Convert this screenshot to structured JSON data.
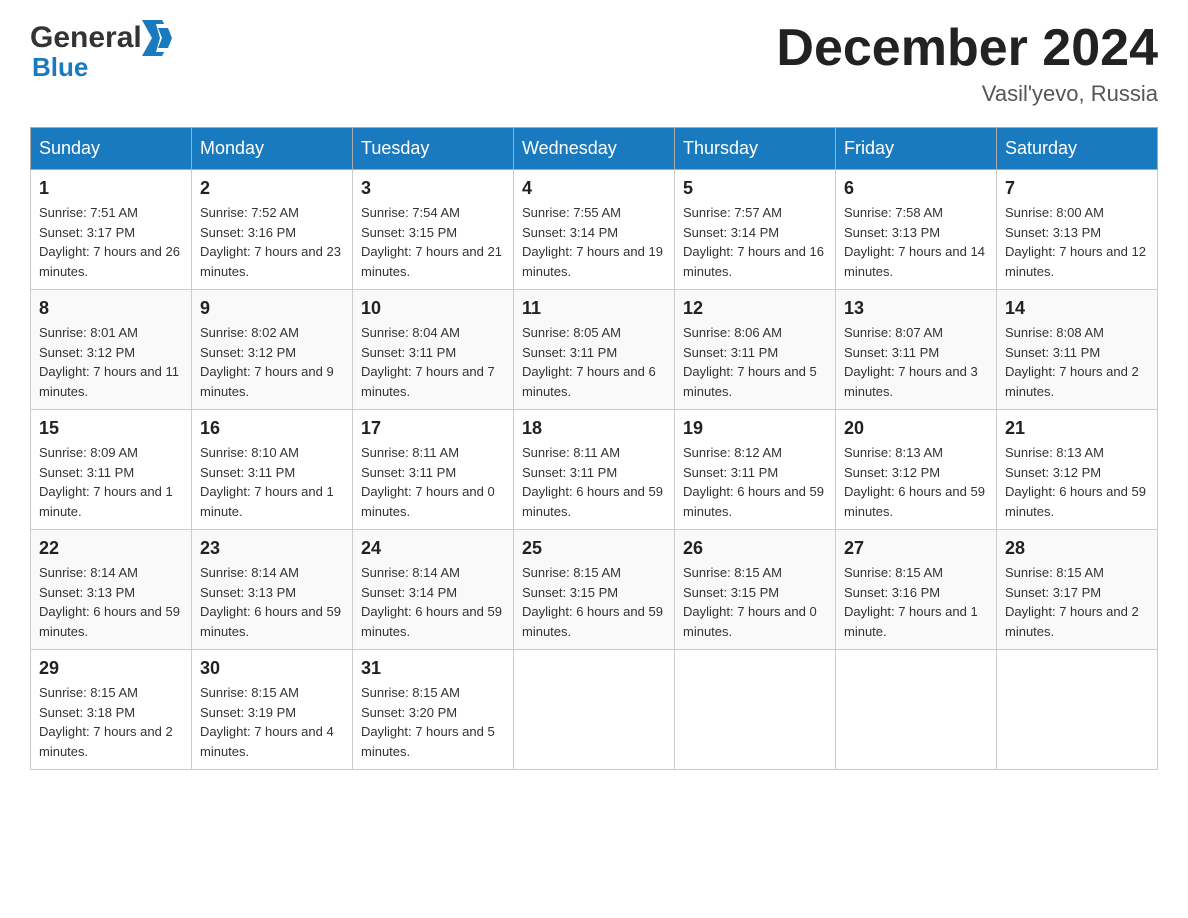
{
  "header": {
    "logo_general": "General",
    "logo_blue": "Blue",
    "month_title": "December 2024",
    "location": "Vasil'yevo, Russia"
  },
  "days_of_week": [
    "Sunday",
    "Monday",
    "Tuesday",
    "Wednesday",
    "Thursday",
    "Friday",
    "Saturday"
  ],
  "weeks": [
    [
      {
        "day": "1",
        "sunrise": "Sunrise: 7:51 AM",
        "sunset": "Sunset: 3:17 PM",
        "daylight": "Daylight: 7 hours and 26 minutes."
      },
      {
        "day": "2",
        "sunrise": "Sunrise: 7:52 AM",
        "sunset": "Sunset: 3:16 PM",
        "daylight": "Daylight: 7 hours and 23 minutes."
      },
      {
        "day": "3",
        "sunrise": "Sunrise: 7:54 AM",
        "sunset": "Sunset: 3:15 PM",
        "daylight": "Daylight: 7 hours and 21 minutes."
      },
      {
        "day": "4",
        "sunrise": "Sunrise: 7:55 AM",
        "sunset": "Sunset: 3:14 PM",
        "daylight": "Daylight: 7 hours and 19 minutes."
      },
      {
        "day": "5",
        "sunrise": "Sunrise: 7:57 AM",
        "sunset": "Sunset: 3:14 PM",
        "daylight": "Daylight: 7 hours and 16 minutes."
      },
      {
        "day": "6",
        "sunrise": "Sunrise: 7:58 AM",
        "sunset": "Sunset: 3:13 PM",
        "daylight": "Daylight: 7 hours and 14 minutes."
      },
      {
        "day": "7",
        "sunrise": "Sunrise: 8:00 AM",
        "sunset": "Sunset: 3:13 PM",
        "daylight": "Daylight: 7 hours and 12 minutes."
      }
    ],
    [
      {
        "day": "8",
        "sunrise": "Sunrise: 8:01 AM",
        "sunset": "Sunset: 3:12 PM",
        "daylight": "Daylight: 7 hours and 11 minutes."
      },
      {
        "day": "9",
        "sunrise": "Sunrise: 8:02 AM",
        "sunset": "Sunset: 3:12 PM",
        "daylight": "Daylight: 7 hours and 9 minutes."
      },
      {
        "day": "10",
        "sunrise": "Sunrise: 8:04 AM",
        "sunset": "Sunset: 3:11 PM",
        "daylight": "Daylight: 7 hours and 7 minutes."
      },
      {
        "day": "11",
        "sunrise": "Sunrise: 8:05 AM",
        "sunset": "Sunset: 3:11 PM",
        "daylight": "Daylight: 7 hours and 6 minutes."
      },
      {
        "day": "12",
        "sunrise": "Sunrise: 8:06 AM",
        "sunset": "Sunset: 3:11 PM",
        "daylight": "Daylight: 7 hours and 5 minutes."
      },
      {
        "day": "13",
        "sunrise": "Sunrise: 8:07 AM",
        "sunset": "Sunset: 3:11 PM",
        "daylight": "Daylight: 7 hours and 3 minutes."
      },
      {
        "day": "14",
        "sunrise": "Sunrise: 8:08 AM",
        "sunset": "Sunset: 3:11 PM",
        "daylight": "Daylight: 7 hours and 2 minutes."
      }
    ],
    [
      {
        "day": "15",
        "sunrise": "Sunrise: 8:09 AM",
        "sunset": "Sunset: 3:11 PM",
        "daylight": "Daylight: 7 hours and 1 minute."
      },
      {
        "day": "16",
        "sunrise": "Sunrise: 8:10 AM",
        "sunset": "Sunset: 3:11 PM",
        "daylight": "Daylight: 7 hours and 1 minute."
      },
      {
        "day": "17",
        "sunrise": "Sunrise: 8:11 AM",
        "sunset": "Sunset: 3:11 PM",
        "daylight": "Daylight: 7 hours and 0 minutes."
      },
      {
        "day": "18",
        "sunrise": "Sunrise: 8:11 AM",
        "sunset": "Sunset: 3:11 PM",
        "daylight": "Daylight: 6 hours and 59 minutes."
      },
      {
        "day": "19",
        "sunrise": "Sunrise: 8:12 AM",
        "sunset": "Sunset: 3:11 PM",
        "daylight": "Daylight: 6 hours and 59 minutes."
      },
      {
        "day": "20",
        "sunrise": "Sunrise: 8:13 AM",
        "sunset": "Sunset: 3:12 PM",
        "daylight": "Daylight: 6 hours and 59 minutes."
      },
      {
        "day": "21",
        "sunrise": "Sunrise: 8:13 AM",
        "sunset": "Sunset: 3:12 PM",
        "daylight": "Daylight: 6 hours and 59 minutes."
      }
    ],
    [
      {
        "day": "22",
        "sunrise": "Sunrise: 8:14 AM",
        "sunset": "Sunset: 3:13 PM",
        "daylight": "Daylight: 6 hours and 59 minutes."
      },
      {
        "day": "23",
        "sunrise": "Sunrise: 8:14 AM",
        "sunset": "Sunset: 3:13 PM",
        "daylight": "Daylight: 6 hours and 59 minutes."
      },
      {
        "day": "24",
        "sunrise": "Sunrise: 8:14 AM",
        "sunset": "Sunset: 3:14 PM",
        "daylight": "Daylight: 6 hours and 59 minutes."
      },
      {
        "day": "25",
        "sunrise": "Sunrise: 8:15 AM",
        "sunset": "Sunset: 3:15 PM",
        "daylight": "Daylight: 6 hours and 59 minutes."
      },
      {
        "day": "26",
        "sunrise": "Sunrise: 8:15 AM",
        "sunset": "Sunset: 3:15 PM",
        "daylight": "Daylight: 7 hours and 0 minutes."
      },
      {
        "day": "27",
        "sunrise": "Sunrise: 8:15 AM",
        "sunset": "Sunset: 3:16 PM",
        "daylight": "Daylight: 7 hours and 1 minute."
      },
      {
        "day": "28",
        "sunrise": "Sunrise: 8:15 AM",
        "sunset": "Sunset: 3:17 PM",
        "daylight": "Daylight: 7 hours and 2 minutes."
      }
    ],
    [
      {
        "day": "29",
        "sunrise": "Sunrise: 8:15 AM",
        "sunset": "Sunset: 3:18 PM",
        "daylight": "Daylight: 7 hours and 2 minutes."
      },
      {
        "day": "30",
        "sunrise": "Sunrise: 8:15 AM",
        "sunset": "Sunset: 3:19 PM",
        "daylight": "Daylight: 7 hours and 4 minutes."
      },
      {
        "day": "31",
        "sunrise": "Sunrise: 8:15 AM",
        "sunset": "Sunset: 3:20 PM",
        "daylight": "Daylight: 7 hours and 5 minutes."
      },
      null,
      null,
      null,
      null
    ]
  ]
}
